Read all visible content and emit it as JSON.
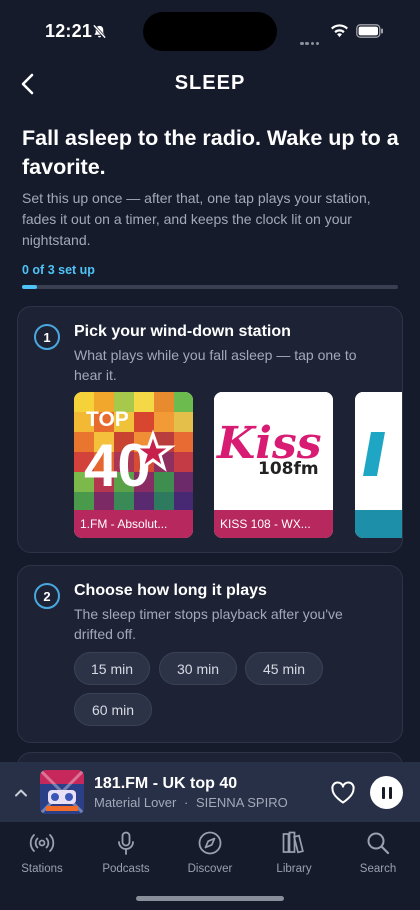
{
  "status_bar": {
    "time": "12:21"
  },
  "header": {
    "title": "SLEEP"
  },
  "intro": {
    "headline": "Fall asleep to the radio. Wake up to a favorite.",
    "description": "Set this up once — after that, one tap plays your station, fades it out on a timer, and keeps the clock lit on your nightstand."
  },
  "progress": {
    "label": "0 of 3 set up",
    "completed": 0,
    "total": 3
  },
  "step1": {
    "number": "1",
    "title": "Pick your wind-down station",
    "description": "What plays while you fall asleep — tap one to hear it.",
    "stations": [
      {
        "name": "1.FM - Absolut...",
        "logo_text": "TOP",
        "logo_number": "40"
      },
      {
        "name": "KISS 108 - WX...",
        "logo_text": "Kiss",
        "logo_number": "108fm"
      },
      {
        "name": ""
      }
    ]
  },
  "step2": {
    "number": "2",
    "title": "Choose how long it plays",
    "description": "The sleep timer stops playback after you've drifted off.",
    "durations": [
      "15 min",
      "30 min",
      "45 min",
      "60 min"
    ]
  },
  "now_playing": {
    "title": "181.FM - UK top 40",
    "artist": "Material Lover",
    "separator": "·",
    "song": "SIENNA SPIRO"
  },
  "tabs": [
    {
      "label": "Stations",
      "icon": "radio-waves-icon"
    },
    {
      "label": "Podcasts",
      "icon": "microphone-icon"
    },
    {
      "label": "Discover",
      "icon": "compass-icon"
    },
    {
      "label": "Library",
      "icon": "library-icon"
    },
    {
      "label": "Search",
      "icon": "search-icon"
    }
  ],
  "colors": {
    "background": "#161b2b",
    "accent": "#4fc3f7",
    "card": "#1d2335",
    "station_label": "#b7285e"
  }
}
